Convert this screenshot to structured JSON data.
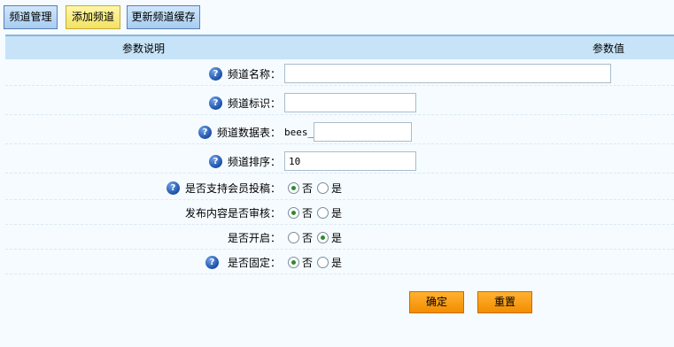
{
  "toolbar": {
    "channel_manage": "频道管理",
    "add_channel": "添加频道",
    "update_cache": "更新频道缓存"
  },
  "table": {
    "header_desc": "参数说明",
    "header_value": "参数值"
  },
  "fields": {
    "channel_name": {
      "label": "频道名称：",
      "value": ""
    },
    "channel_id": {
      "label": "频道标识：",
      "value": ""
    },
    "channel_table": {
      "label": "频道数据表：",
      "prefix": "bees_",
      "value": ""
    },
    "channel_order": {
      "label": "频道排序：",
      "value": "10"
    },
    "member_submit": {
      "label": "是否支持会员投稿：",
      "no": "否",
      "yes": "是",
      "selected": "no"
    },
    "review": {
      "label": "发布内容是否审核：",
      "no": "否",
      "yes": "是",
      "selected": "no"
    },
    "enabled": {
      "label": "是否开启：",
      "no": "否",
      "yes": "是",
      "selected": "yes"
    },
    "fixed": {
      "label": "是否固定：",
      "no": "否",
      "yes": "是",
      "selected": "no"
    }
  },
  "actions": {
    "confirm": "确定",
    "reset": "重置"
  },
  "icons": {
    "help": "help-circle-icon"
  },
  "colors": {
    "header_bg": "#c6e3f8",
    "action_button": "#f7a01b",
    "add_button": "#f2e263"
  }
}
